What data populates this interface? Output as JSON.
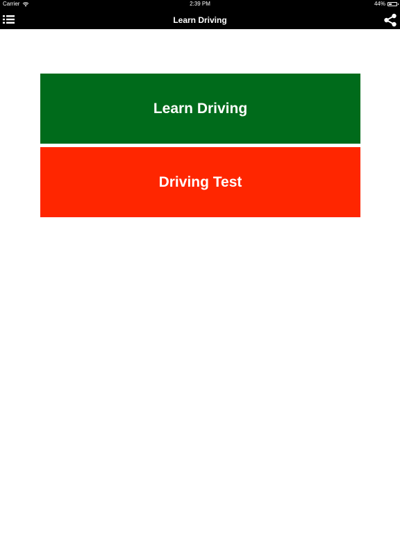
{
  "status_bar": {
    "carrier": "Carrier",
    "time": "2:39 PM",
    "battery": "44%",
    "battery_level": 0.44
  },
  "nav": {
    "title": "Learn Driving",
    "menu_icon": "list-menu-icon",
    "share_icon": "share-icon"
  },
  "tiles": [
    {
      "label": "Learn Driving",
      "color": "#006b1b"
    },
    {
      "label": "Driving Test",
      "color": "#ff2600"
    }
  ]
}
